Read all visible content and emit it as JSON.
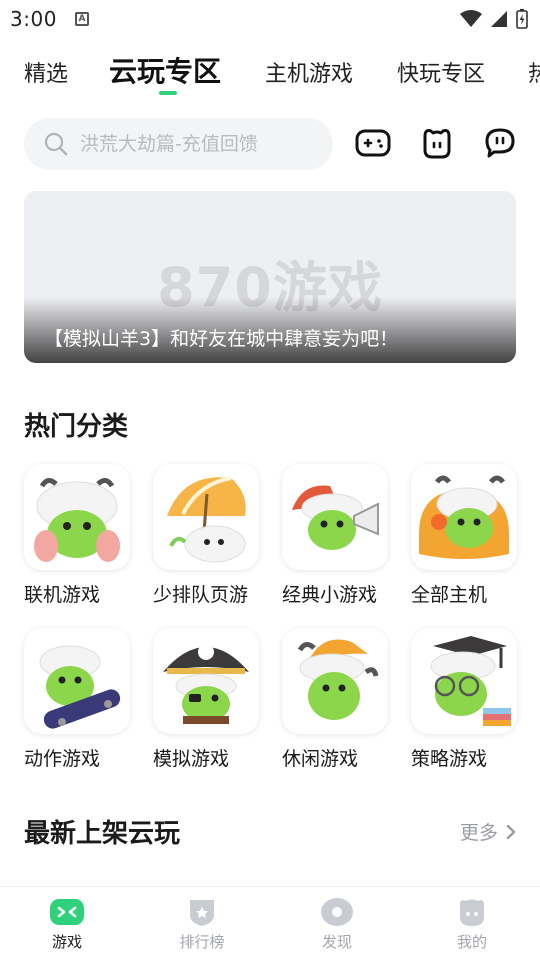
{
  "status_bar": {
    "time": "3:00",
    "notif_glyph": "A"
  },
  "tabs": [
    {
      "label": "精选"
    },
    {
      "label": "云玩专区"
    },
    {
      "label": "主机游戏"
    },
    {
      "label": "快玩专区"
    },
    {
      "label": "热"
    }
  ],
  "search": {
    "placeholder": "洪荒大劫篇-充值回馈"
  },
  "header_icons": [
    "gamepad-icon",
    "cat-face-icon",
    "chat-bubble-icon"
  ],
  "banner": {
    "watermark": "870游戏",
    "caption": "【模拟山羊3】和好友在城中肆意妄为吧！"
  },
  "hot_categories": {
    "title": "热门分类",
    "items": [
      {
        "label": "联机游戏",
        "icon": "goat-mascot-icon"
      },
      {
        "label": "少排队页游",
        "icon": "umbrella-mascot-icon"
      },
      {
        "label": "经典小游戏",
        "icon": "megaphone-mascot-icon"
      },
      {
        "label": "全部主机",
        "icon": "console-mascot-icon"
      },
      {
        "label": "动作游戏",
        "icon": "skateboard-mascot-icon"
      },
      {
        "label": "模拟游戏",
        "icon": "pirate-mascot-icon"
      },
      {
        "label": "休闲游戏",
        "icon": "cap-mascot-icon"
      },
      {
        "label": "策略游戏",
        "icon": "graduate-mascot-icon"
      }
    ]
  },
  "new_cloud": {
    "title": "最新上架云玩",
    "more": "更多"
  },
  "bottom_nav": [
    {
      "label": "游戏",
      "active": true
    },
    {
      "label": "排行榜"
    },
    {
      "label": "发现"
    },
    {
      "label": "我的"
    }
  ],
  "colors": {
    "accent": "#2fd27a",
    "mascot_green": "#8bd64a",
    "inactive": "#a3a6ab"
  }
}
